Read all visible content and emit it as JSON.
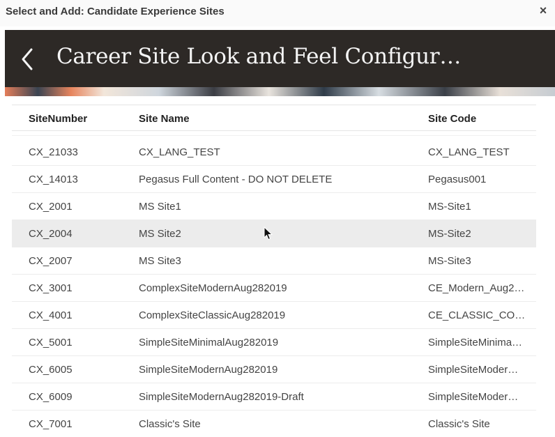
{
  "dialog": {
    "title": "Select and Add: Candidate Experience Sites",
    "close_label": "×"
  },
  "banner": {
    "title": "Career Site Look and Feel Configur…"
  },
  "table": {
    "headers": {
      "site_number": "SiteNumber",
      "site_name": "Site Name",
      "site_code": "Site Code"
    },
    "rows": [
      {
        "num": "CX_21033",
        "name": "CX_LANG_TEST",
        "code": "CX_LANG_TEST"
      },
      {
        "num": "CX_14013",
        "name": "Pegasus Full Content - DO NOT DELETE",
        "code": "Pegasus001"
      },
      {
        "num": "CX_2001",
        "name": "MS Site1",
        "code": "MS-Site1"
      },
      {
        "num": "CX_2004",
        "name": "MS Site2",
        "code": "MS-Site2"
      },
      {
        "num": "CX_2007",
        "name": "MS Site3",
        "code": "MS-Site3"
      },
      {
        "num": "CX_3001",
        "name": "ComplexSiteModernAug282019",
        "code": "CE_Modern_Aug2…"
      },
      {
        "num": "CX_4001",
        "name": "ComplexSiteClassicAug282019",
        "code": "CE_CLASSIC_CO…"
      },
      {
        "num": "CX_5001",
        "name": "SimpleSiteMinimalAug282019",
        "code": "SimpleSiteMinima…"
      },
      {
        "num": "CX_6005",
        "name": "SimpleSiteModernAug282019",
        "code": "SimpleSiteModer…"
      },
      {
        "num": "CX_6009",
        "name": "SimpleSiteModernAug282019-Draft",
        "code": "SimpleSiteModer…"
      },
      {
        "num": "CX_7001",
        "name": "Classic's Site",
        "code": "Classic's Site"
      }
    ],
    "hovered_row": 3
  }
}
